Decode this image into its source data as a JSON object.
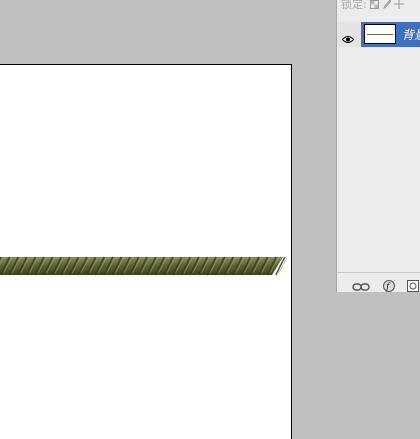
{
  "layers_panel": {
    "lock_label": "锁定:",
    "layers": [
      {
        "name": "背景",
        "visible": true,
        "selected": true
      }
    ],
    "bottom_icons": [
      "link-icon",
      "fx-icon",
      "mask-icon"
    ]
  },
  "document": {
    "background": "#ffffff",
    "content": "rope-stroke",
    "rope_color": "#5f6434"
  },
  "colors": {
    "workspace": "#c0c0c0",
    "selection": "#3f6fc1",
    "panel": "#ececec"
  }
}
